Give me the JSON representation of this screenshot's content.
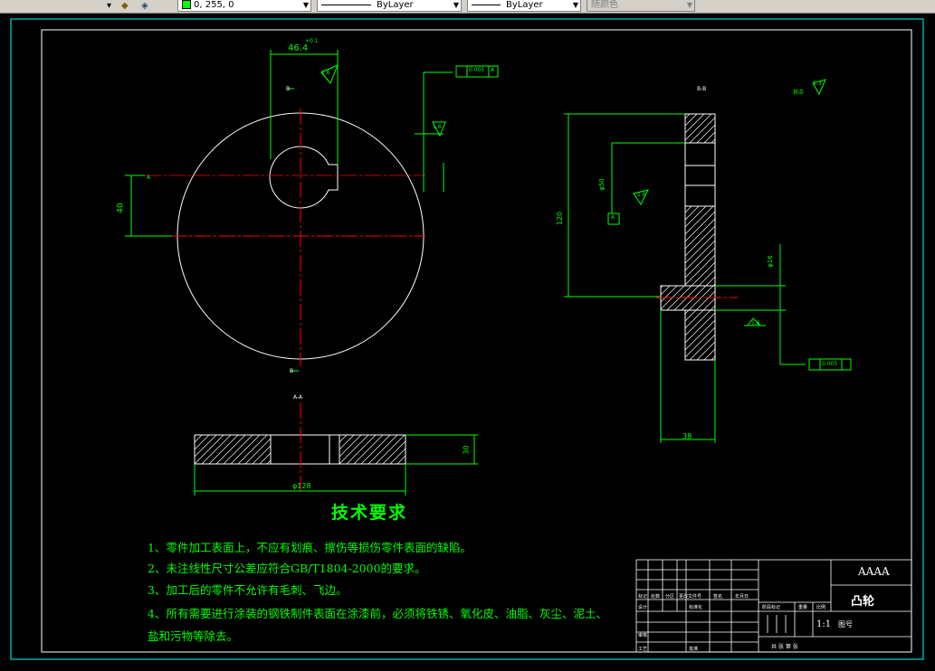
{
  "toolbar": {
    "layer_icon": "layers-icon",
    "color_value": "0, 255, 0",
    "linetype": "ByLayer",
    "lineweight": "ByLayer",
    "plotstyle": "随颜色"
  },
  "drawing": {
    "dims": {
      "slot_width": "46.4",
      "slot_width_tol": "+0.1",
      "height_40": "40",
      "diameter_120": "120",
      "thickness_30": "30",
      "bore_dia": "φ16",
      "shaft_dia": "φ50",
      "width_38": "38",
      "phi128": "φ128",
      "roughness_16a": "1.6",
      "roughness_16b": "1.6",
      "roughness_16c": "1.6",
      "roughness_16d": "1.6",
      "roughness_rest": "6.3",
      "rest_label": "其余",
      "tol_frame_1": "0.005",
      "tol_frame_2": "0.005",
      "datum_a": "A",
      "datum_b": "A",
      "datum_c": "A",
      "section_bb": "B-B",
      "section_aa": "A-A",
      "cut_b_top": "B",
      "cut_b_bottom": "B"
    },
    "tech_title": "技术要求",
    "requirements": [
      "1、零件加工表面上，不应有划痕、擦伤等损伤零件表面的缺陷。",
      "2、未注线性尺寸公差应符合GB/T1804-2000的要求。",
      "3、加工后的零件不允许有毛刺、飞边。",
      "4、所有需要进行涂装的钢铁制件表面在涂漆前，必须将铁锈、氧化皮、油脂、灰尘、泥土、",
      "盐和污物等除去。"
    ],
    "title_block": {
      "company": "AAAA",
      "part_name": "凸轮",
      "scale": "1:1",
      "drawing_no_label": "图号",
      "stage_label": "阶段标记",
      "weight_label": "重量",
      "scale_label": "比例",
      "sheet_info": "共 张 第 张",
      "mark": "标记",
      "count": "处数",
      "zone": "分区",
      "change_doc": "更改文件号",
      "sign": "签名",
      "date": "年月日",
      "design": "设计",
      "standardize": "标准化",
      "review": "审核",
      "process": "工艺",
      "approve": "批准"
    }
  }
}
